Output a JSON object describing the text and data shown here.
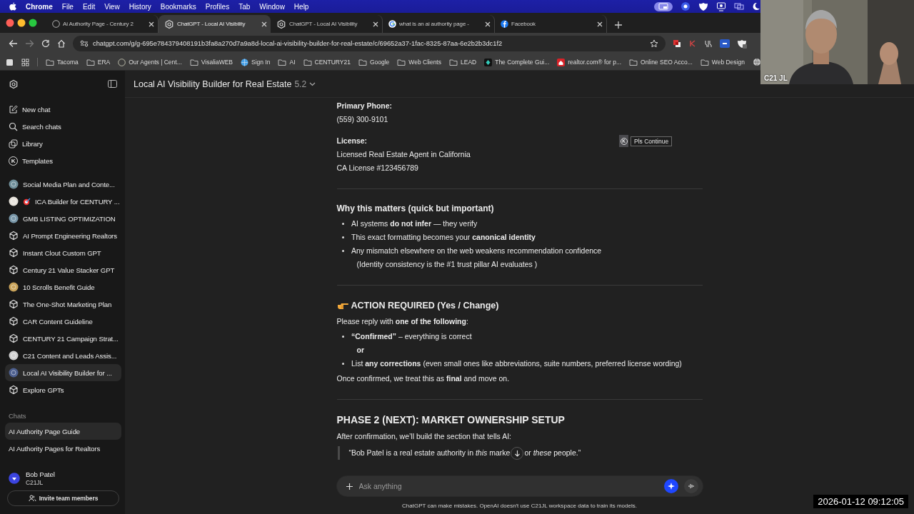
{
  "menubar": {
    "app": "Chrome",
    "items": [
      "File",
      "Edit",
      "View",
      "History",
      "Bookmarks",
      "Profiles",
      "Tab",
      "Window",
      "Help"
    ]
  },
  "browser": {
    "tabs": [
      {
        "title": "Ai Authority Page - Century 2",
        "selected": false
      },
      {
        "title": "ChatGPT - Local AI Visibility",
        "selected": true
      },
      {
        "title": "ChatGPT - Local AI Visibility",
        "selected": false
      },
      {
        "title": "what is an ai authority page -",
        "selected": false
      },
      {
        "title": "Facebook",
        "selected": false
      }
    ],
    "url": "chatgpt.com/g/g-695e784379408191b3fa8a270d7a9a8d-local-ai-visibility-builder-for-real-estate/c/69652a37-1fac-8325-87aa-6e2b2b3dc1f2",
    "bookmarks": [
      {
        "label": "Tacoma"
      },
      {
        "label": "ERA"
      },
      {
        "label": "Our Agents | Cent..."
      },
      {
        "label": "VisaliaWEB"
      },
      {
        "label": "Sign In"
      },
      {
        "label": "AI"
      },
      {
        "label": "CENTURY21"
      },
      {
        "label": "Google"
      },
      {
        "label": "Web Clients"
      },
      {
        "label": "LEAD"
      },
      {
        "label": "The Complete Gui..."
      },
      {
        "label": "realtor.com® for p..."
      },
      {
        "label": "Online SEO Acco..."
      },
      {
        "label": "Web Design"
      }
    ]
  },
  "sidebar": {
    "nav": [
      {
        "label": "New chat"
      },
      {
        "label": "Search chats"
      },
      {
        "label": "Library"
      },
      {
        "label": "Templates",
        "icon_text": "K"
      }
    ],
    "gpts": [
      {
        "label": "Social Media Plan and Conte...",
        "selected": false
      },
      {
        "label": "ICA Builder for CENTURY ...",
        "selected": false
      },
      {
        "label": "GMB LISTING OPTIMIZATION",
        "selected": false
      },
      {
        "label": "AI Prompt Engineering Realtors",
        "selected": false
      },
      {
        "label": "Instant Clout Custom GPT",
        "selected": false
      },
      {
        "label": "Century 21 Value Stacker GPT",
        "selected": false
      },
      {
        "label": "10 Scrolls Benefit Guide",
        "selected": false
      },
      {
        "label": "The One-Shot Marketing Plan",
        "selected": false
      },
      {
        "label": "CAR Content Guideline",
        "selected": false
      },
      {
        "label": "CENTURY 21 Campaign Strat...",
        "selected": false
      },
      {
        "label": "C21 Content and Leads Assis...",
        "selected": false
      },
      {
        "label": "Local AI Visibility Builder for ...",
        "selected": true
      },
      {
        "label": "Explore GPTs",
        "selected": false
      }
    ],
    "chats_label": "Chats",
    "chats": [
      {
        "label": "AI Authority Page Guide",
        "selected": true
      },
      {
        "label": "AI Authority Pages for Realtors",
        "selected": false
      }
    ],
    "user": {
      "name": "Bob Patel",
      "org": "C21JL"
    },
    "invite_button": "Invite team members"
  },
  "header": {
    "title": "Local AI Visibility Builder for Real Estate",
    "version": "5.2"
  },
  "content": [
    {
      "kind": "field",
      "label": "Primary Phone:",
      "lines": [
        "(559) 300-9101"
      ]
    },
    {
      "kind": "field",
      "label": "License:",
      "lines": [
        "Licensed Real Estate Agent in California",
        "CA License #123456789"
      ]
    },
    {
      "kind": "rule"
    },
    {
      "kind": "heading",
      "text": "Why this matters (quick but important)"
    },
    {
      "kind": "bullets",
      "items": [
        {
          "kind": "bullet",
          "text": "AI systems **do not infer** — they verify"
        },
        {
          "kind": "bullet",
          "text": "This exact formatting becomes your **canonical identity**"
        },
        {
          "kind": "bullet",
          "text": "Any mismatch elsewhere on the web weakens recommendation confidence"
        },
        {
          "kind": "continuation",
          "text": "(Identity consistency is the #1 trust pillar AI evaluates )"
        }
      ]
    },
    {
      "kind": "rule"
    },
    {
      "kind": "action",
      "text": "ACTION REQUIRED (Yes / Change)"
    },
    {
      "kind": "paragraph",
      "text": "Please reply with **one of the following**:"
    },
    {
      "kind": "bullets",
      "items": [
        {
          "kind": "bullet",
          "text": "**“Confirmed”** – everything is correct"
        },
        {
          "kind": "connector",
          "text": "**or**"
        },
        {
          "kind": "bullet",
          "text": "List **any corrections** (even small ones like abbreviations, suite numbers, preferred license wording)"
        }
      ]
    },
    {
      "kind": "paragraph",
      "text": "Once confirmed, we treat this as **final** and move on."
    },
    {
      "kind": "rule"
    },
    {
      "kind": "phase",
      "text": "PHASE 2 (NEXT): MARKET OWNERSHIP SETUP"
    },
    {
      "kind": "paragraph",
      "text": "After confirmation, we’ll build the section that tells AI:"
    },
    {
      "kind": "quote",
      "before": "“Bob Patel is a real estate authority in *this* marke",
      "after": "or *these* people.”"
    }
  ],
  "floating_button": {
    "icon_text": "K",
    "label": "Pls Continue"
  },
  "composer": {
    "placeholder": "Ask anything"
  },
  "disclaimer": "ChatGPT can make mistakes. OpenAI doesn't use C21JL workspace data to train its models.",
  "webcam": {
    "name": "C21 JL"
  },
  "recording_time": "2026-01-12 09:12:05"
}
